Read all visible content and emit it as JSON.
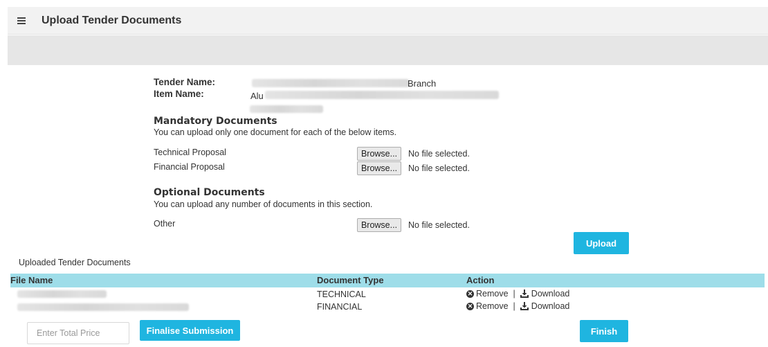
{
  "header": {
    "title": "Upload Tender Documents"
  },
  "tender": {
    "tender_name_label": "Tender Name:",
    "tender_name_value": "Branch",
    "item_name_label": "Item Name:",
    "item_name_value": "Alu"
  },
  "mandatory": {
    "title": "Mandatory Documents",
    "description": "You can upload only one document for each of the below items.",
    "rows": [
      {
        "label": "Technical Proposal",
        "browse": "Browse...",
        "status": "No file selected."
      },
      {
        "label": "Financial Proposal",
        "browse": "Browse...",
        "status": "No file selected."
      }
    ]
  },
  "optional": {
    "title": "Optional Documents",
    "description": "You can upload any number of documents in this section.",
    "rows": [
      {
        "label": "Other",
        "browse": "Browse...",
        "status": "No file selected."
      }
    ]
  },
  "upload_button": "Upload",
  "uploaded": {
    "title": "Uploaded Tender Documents",
    "columns": [
      "File Name",
      "Document Type",
      "Action"
    ],
    "rows": [
      {
        "type": "TECHNICAL",
        "remove": "Remove",
        "separator": "|",
        "download": "Download"
      },
      {
        "type": "FINANCIAL",
        "remove": "Remove",
        "separator": "|",
        "download": "Download"
      }
    ]
  },
  "footer": {
    "price_placeholder": "Enter Total Price",
    "finalise_button": "Finalise Submission",
    "finish_button": "Finish"
  },
  "colors": {
    "accent": "#1fb5e0",
    "table_header": "#9edde9",
    "header_bg": "#f2f2f2",
    "band_bg": "#e6e6e6"
  },
  "icons": [
    "menu-icon",
    "remove-icon",
    "download-icon"
  ]
}
